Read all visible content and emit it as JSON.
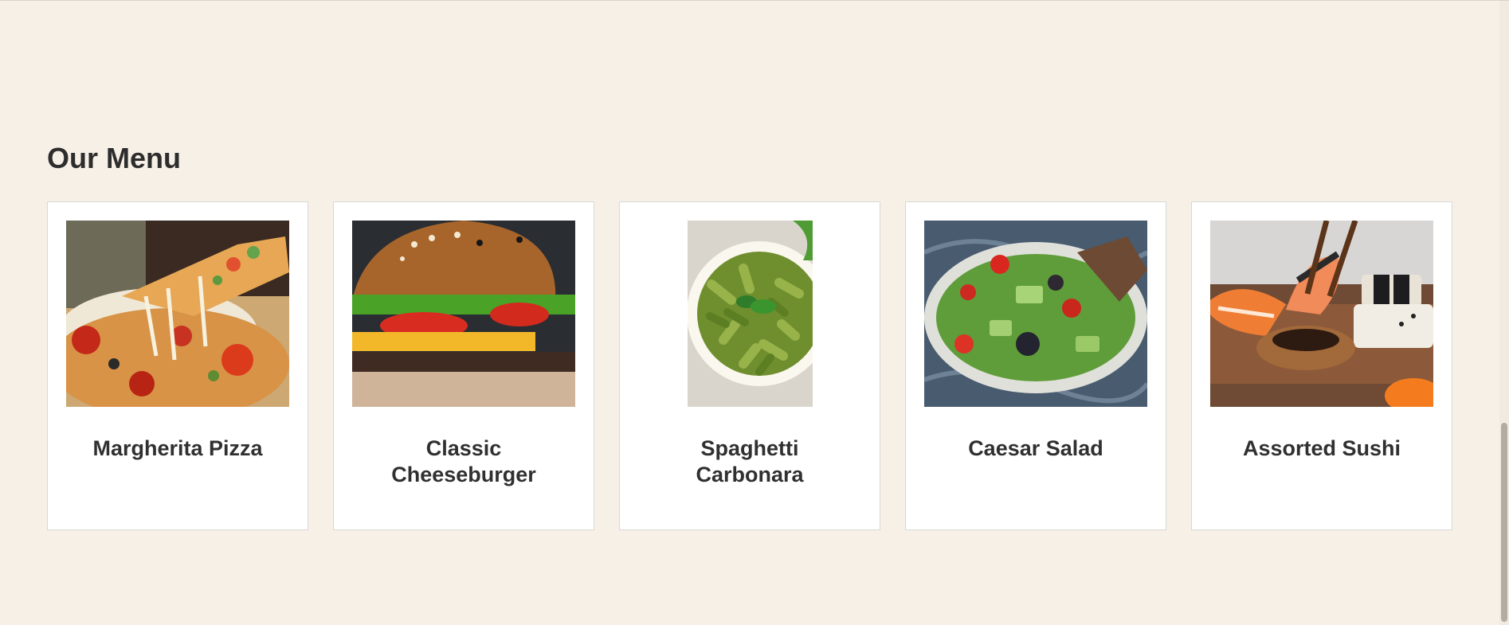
{
  "menu": {
    "title": "Our Menu",
    "items": [
      {
        "name": "Margherita Pizza",
        "image": "pizza-photo"
      },
      {
        "name": "Classic Cheeseburger",
        "image": "cheeseburger-photo"
      },
      {
        "name": "Spaghetti Carbonara",
        "image": "pasta-photo"
      },
      {
        "name": "Caesar Salad",
        "image": "salad-photo"
      },
      {
        "name": "Assorted Sushi",
        "image": "sushi-photo"
      }
    ]
  }
}
